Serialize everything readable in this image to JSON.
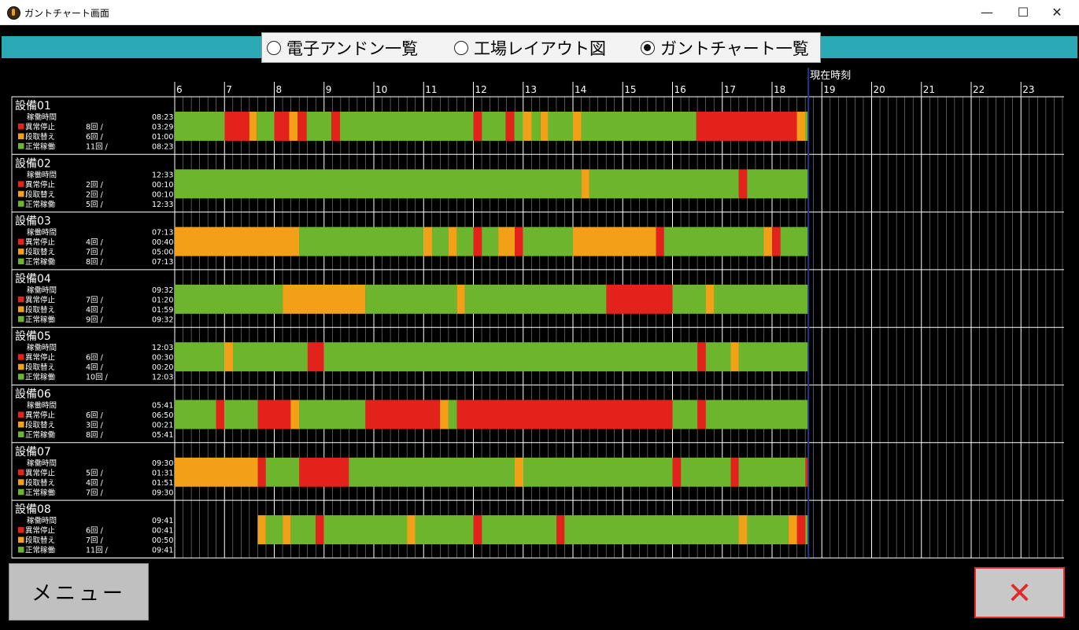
{
  "window": {
    "title": "ガントチャート画面",
    "minimize": "—",
    "maximize": "☐",
    "close": "✕"
  },
  "view_selector": {
    "options": [
      {
        "label": "電子アンドン一覧",
        "selected": false
      },
      {
        "label": "工場レイアウト図",
        "selected": false
      },
      {
        "label": "ガントチャート一覧",
        "selected": true
      }
    ]
  },
  "colors": {
    "running": "#6cb52d",
    "abnormal_stop": "#e3221c",
    "setup_change": "#f2a018",
    "teal": "#2aa9b5",
    "now_line": "#1e3a8a"
  },
  "legend_labels": {
    "operating_time": "稼働時間",
    "abnormal_stop": "異常停止",
    "setup_change": "段取替え",
    "normal_running": "正常稼働"
  },
  "now_label": "現在時刻",
  "chart_data": {
    "type": "gantt",
    "x_unit": "hour",
    "xlim": [
      6,
      24
    ],
    "hour_ticks": [
      "6",
      "7",
      "8",
      "9",
      "10",
      "11",
      "12",
      "13",
      "14",
      "15",
      "16",
      "17",
      "18",
      "19",
      "20",
      "21",
      "22",
      "23"
    ],
    "now": 18.73,
    "categories": [
      "running",
      "abnormal_stop",
      "setup_change"
    ],
    "machines": [
      {
        "name": "設備01",
        "operating_time": "08:23",
        "abnormal": {
          "count": "8回 /",
          "time": "03:29"
        },
        "setup": {
          "count": "6回 /",
          "time": "01:00"
        },
        "normal": {
          "count": "11回 /",
          "time": "08:23"
        },
        "segments": [
          [
            6.0,
            7.0,
            "running"
          ],
          [
            7.0,
            7.5,
            "abnormal_stop"
          ],
          [
            7.5,
            7.65,
            "setup_change"
          ],
          [
            7.65,
            8.0,
            "running"
          ],
          [
            8.0,
            8.3,
            "abnormal_stop"
          ],
          [
            8.3,
            8.47,
            "setup_change"
          ],
          [
            8.47,
            8.65,
            "abnormal_stop"
          ],
          [
            8.65,
            9.15,
            "running"
          ],
          [
            9.15,
            9.32,
            "abnormal_stop"
          ],
          [
            9.32,
            12.0,
            "running"
          ],
          [
            12.0,
            12.17,
            "abnormal_stop"
          ],
          [
            12.17,
            12.65,
            "running"
          ],
          [
            12.65,
            12.82,
            "abnormal_stop"
          ],
          [
            12.82,
            13.0,
            "running"
          ],
          [
            13.0,
            13.17,
            "setup_change"
          ],
          [
            13.17,
            13.35,
            "running"
          ],
          [
            13.35,
            13.5,
            "setup_change"
          ],
          [
            13.5,
            14.0,
            "running"
          ],
          [
            14.0,
            14.17,
            "setup_change"
          ],
          [
            14.17,
            16.48,
            "running"
          ],
          [
            16.48,
            18.5,
            "abnormal_stop"
          ],
          [
            18.5,
            18.67,
            "setup_change"
          ],
          [
            18.67,
            18.73,
            "running"
          ]
        ]
      },
      {
        "name": "設備02",
        "operating_time": "12:33",
        "abnormal": {
          "count": "2回 /",
          "time": "00:10"
        },
        "setup": {
          "count": "2回 /",
          "time": "00:10"
        },
        "normal": {
          "count": "5回 /",
          "time": "12:33"
        },
        "segments": [
          [
            6.0,
            14.17,
            "running"
          ],
          [
            14.17,
            14.33,
            "setup_change"
          ],
          [
            14.33,
            17.33,
            "running"
          ],
          [
            17.33,
            17.5,
            "abnormal_stop"
          ],
          [
            17.5,
            18.73,
            "running"
          ]
        ]
      },
      {
        "name": "設備03",
        "operating_time": "07:13",
        "abnormal": {
          "count": "4回 /",
          "time": "00:40"
        },
        "setup": {
          "count": "7回 /",
          "time": "05:00"
        },
        "normal": {
          "count": "8回 /",
          "time": "07:13"
        },
        "segments": [
          [
            6.0,
            8.5,
            "setup_change"
          ],
          [
            8.5,
            11.0,
            "running"
          ],
          [
            11.0,
            11.17,
            "setup_change"
          ],
          [
            11.17,
            11.5,
            "running"
          ],
          [
            11.5,
            11.67,
            "setup_change"
          ],
          [
            11.67,
            12.0,
            "running"
          ],
          [
            12.0,
            12.17,
            "abnormal_stop"
          ],
          [
            12.17,
            12.5,
            "running"
          ],
          [
            12.5,
            12.83,
            "setup_change"
          ],
          [
            12.83,
            13.0,
            "abnormal_stop"
          ],
          [
            13.0,
            14.0,
            "running"
          ],
          [
            14.0,
            15.67,
            "setup_change"
          ],
          [
            15.67,
            15.83,
            "abnormal_stop"
          ],
          [
            15.83,
            17.83,
            "running"
          ],
          [
            17.83,
            18.0,
            "setup_change"
          ],
          [
            18.0,
            18.17,
            "abnormal_stop"
          ],
          [
            18.17,
            18.73,
            "running"
          ]
        ]
      },
      {
        "name": "設備04",
        "operating_time": "09:32",
        "abnormal": {
          "count": "7回 /",
          "time": "01:20"
        },
        "setup": {
          "count": "4回 /",
          "time": "01:59"
        },
        "normal": {
          "count": "9回 /",
          "time": "09:32"
        },
        "segments": [
          [
            6.0,
            8.17,
            "running"
          ],
          [
            8.17,
            9.83,
            "setup_change"
          ],
          [
            9.83,
            11.67,
            "running"
          ],
          [
            11.67,
            11.83,
            "setup_change"
          ],
          [
            11.83,
            14.67,
            "running"
          ],
          [
            14.67,
            16.0,
            "abnormal_stop"
          ],
          [
            16.0,
            16.67,
            "running"
          ],
          [
            16.67,
            16.83,
            "setup_change"
          ],
          [
            16.83,
            18.73,
            "running"
          ]
        ]
      },
      {
        "name": "設備05",
        "operating_time": "12:03",
        "abnormal": {
          "count": "6回 /",
          "time": "00:30"
        },
        "setup": {
          "count": "4回 /",
          "time": "00:20"
        },
        "normal": {
          "count": "10回 /",
          "time": "12:03"
        },
        "segments": [
          [
            6.0,
            7.0,
            "running"
          ],
          [
            7.0,
            7.17,
            "setup_change"
          ],
          [
            7.17,
            8.67,
            "running"
          ],
          [
            8.67,
            9.0,
            "abnormal_stop"
          ],
          [
            9.0,
            16.5,
            "running"
          ],
          [
            16.5,
            16.67,
            "abnormal_stop"
          ],
          [
            16.67,
            17.17,
            "running"
          ],
          [
            17.17,
            17.33,
            "setup_change"
          ],
          [
            17.33,
            18.73,
            "running"
          ]
        ]
      },
      {
        "name": "設備06",
        "operating_time": "05:41",
        "abnormal": {
          "count": "6回 /",
          "time": "06:50"
        },
        "setup": {
          "count": "3回 /",
          "time": "00:21"
        },
        "normal": {
          "count": "8回 /",
          "time": "05:41"
        },
        "segments": [
          [
            6.0,
            6.83,
            "running"
          ],
          [
            6.83,
            7.0,
            "abnormal_stop"
          ],
          [
            7.0,
            7.67,
            "running"
          ],
          [
            7.67,
            8.33,
            "abnormal_stop"
          ],
          [
            8.33,
            8.5,
            "setup_change"
          ],
          [
            8.5,
            9.83,
            "running"
          ],
          [
            9.83,
            11.33,
            "abnormal_stop"
          ],
          [
            11.33,
            11.5,
            "setup_change"
          ],
          [
            11.5,
            11.67,
            "running"
          ],
          [
            11.67,
            16.0,
            "abnormal_stop"
          ],
          [
            16.0,
            16.5,
            "running"
          ],
          [
            16.5,
            16.67,
            "abnormal_stop"
          ],
          [
            16.67,
            18.73,
            "running"
          ]
        ]
      },
      {
        "name": "設備07",
        "operating_time": "09:30",
        "abnormal": {
          "count": "5回 /",
          "time": "01:31"
        },
        "setup": {
          "count": "4回 /",
          "time": "01:51"
        },
        "normal": {
          "count": "7回 /",
          "time": "09:30"
        },
        "segments": [
          [
            6.0,
            7.67,
            "setup_change"
          ],
          [
            7.67,
            7.83,
            "abnormal_stop"
          ],
          [
            7.83,
            8.5,
            "running"
          ],
          [
            8.5,
            9.5,
            "abnormal_stop"
          ],
          [
            9.5,
            12.83,
            "running"
          ],
          [
            12.83,
            13.0,
            "setup_change"
          ],
          [
            13.0,
            16.0,
            "running"
          ],
          [
            16.0,
            16.17,
            "abnormal_stop"
          ],
          [
            16.17,
            17.17,
            "running"
          ],
          [
            17.17,
            17.33,
            "abnormal_stop"
          ],
          [
            17.33,
            18.67,
            "running"
          ],
          [
            18.67,
            18.73,
            "abnormal_stop"
          ]
        ]
      },
      {
        "name": "設備08",
        "operating_time": "09:41",
        "abnormal": {
          "count": "6回 /",
          "time": "00:41"
        },
        "setup": {
          "count": "7回 /",
          "time": "00:50"
        },
        "normal": {
          "count": "11回 /",
          "time": "09:41"
        },
        "segments": [
          [
            7.67,
            7.83,
            "setup_change"
          ],
          [
            7.83,
            8.17,
            "running"
          ],
          [
            8.17,
            8.33,
            "setup_change"
          ],
          [
            8.33,
            8.83,
            "running"
          ],
          [
            8.83,
            9.0,
            "abnormal_stop"
          ],
          [
            9.0,
            10.67,
            "running"
          ],
          [
            10.67,
            10.83,
            "setup_change"
          ],
          [
            10.83,
            12.0,
            "running"
          ],
          [
            12.0,
            12.17,
            "abnormal_stop"
          ],
          [
            12.17,
            13.67,
            "running"
          ],
          [
            13.67,
            13.83,
            "abnormal_stop"
          ],
          [
            13.83,
            17.33,
            "running"
          ],
          [
            17.33,
            17.5,
            "setup_change"
          ],
          [
            17.5,
            18.33,
            "running"
          ],
          [
            18.33,
            18.5,
            "setup_change"
          ],
          [
            18.5,
            18.67,
            "abnormal_stop"
          ],
          [
            18.67,
            18.73,
            "running"
          ]
        ]
      }
    ]
  },
  "buttons": {
    "menu": "メニュー",
    "close": "✕"
  }
}
